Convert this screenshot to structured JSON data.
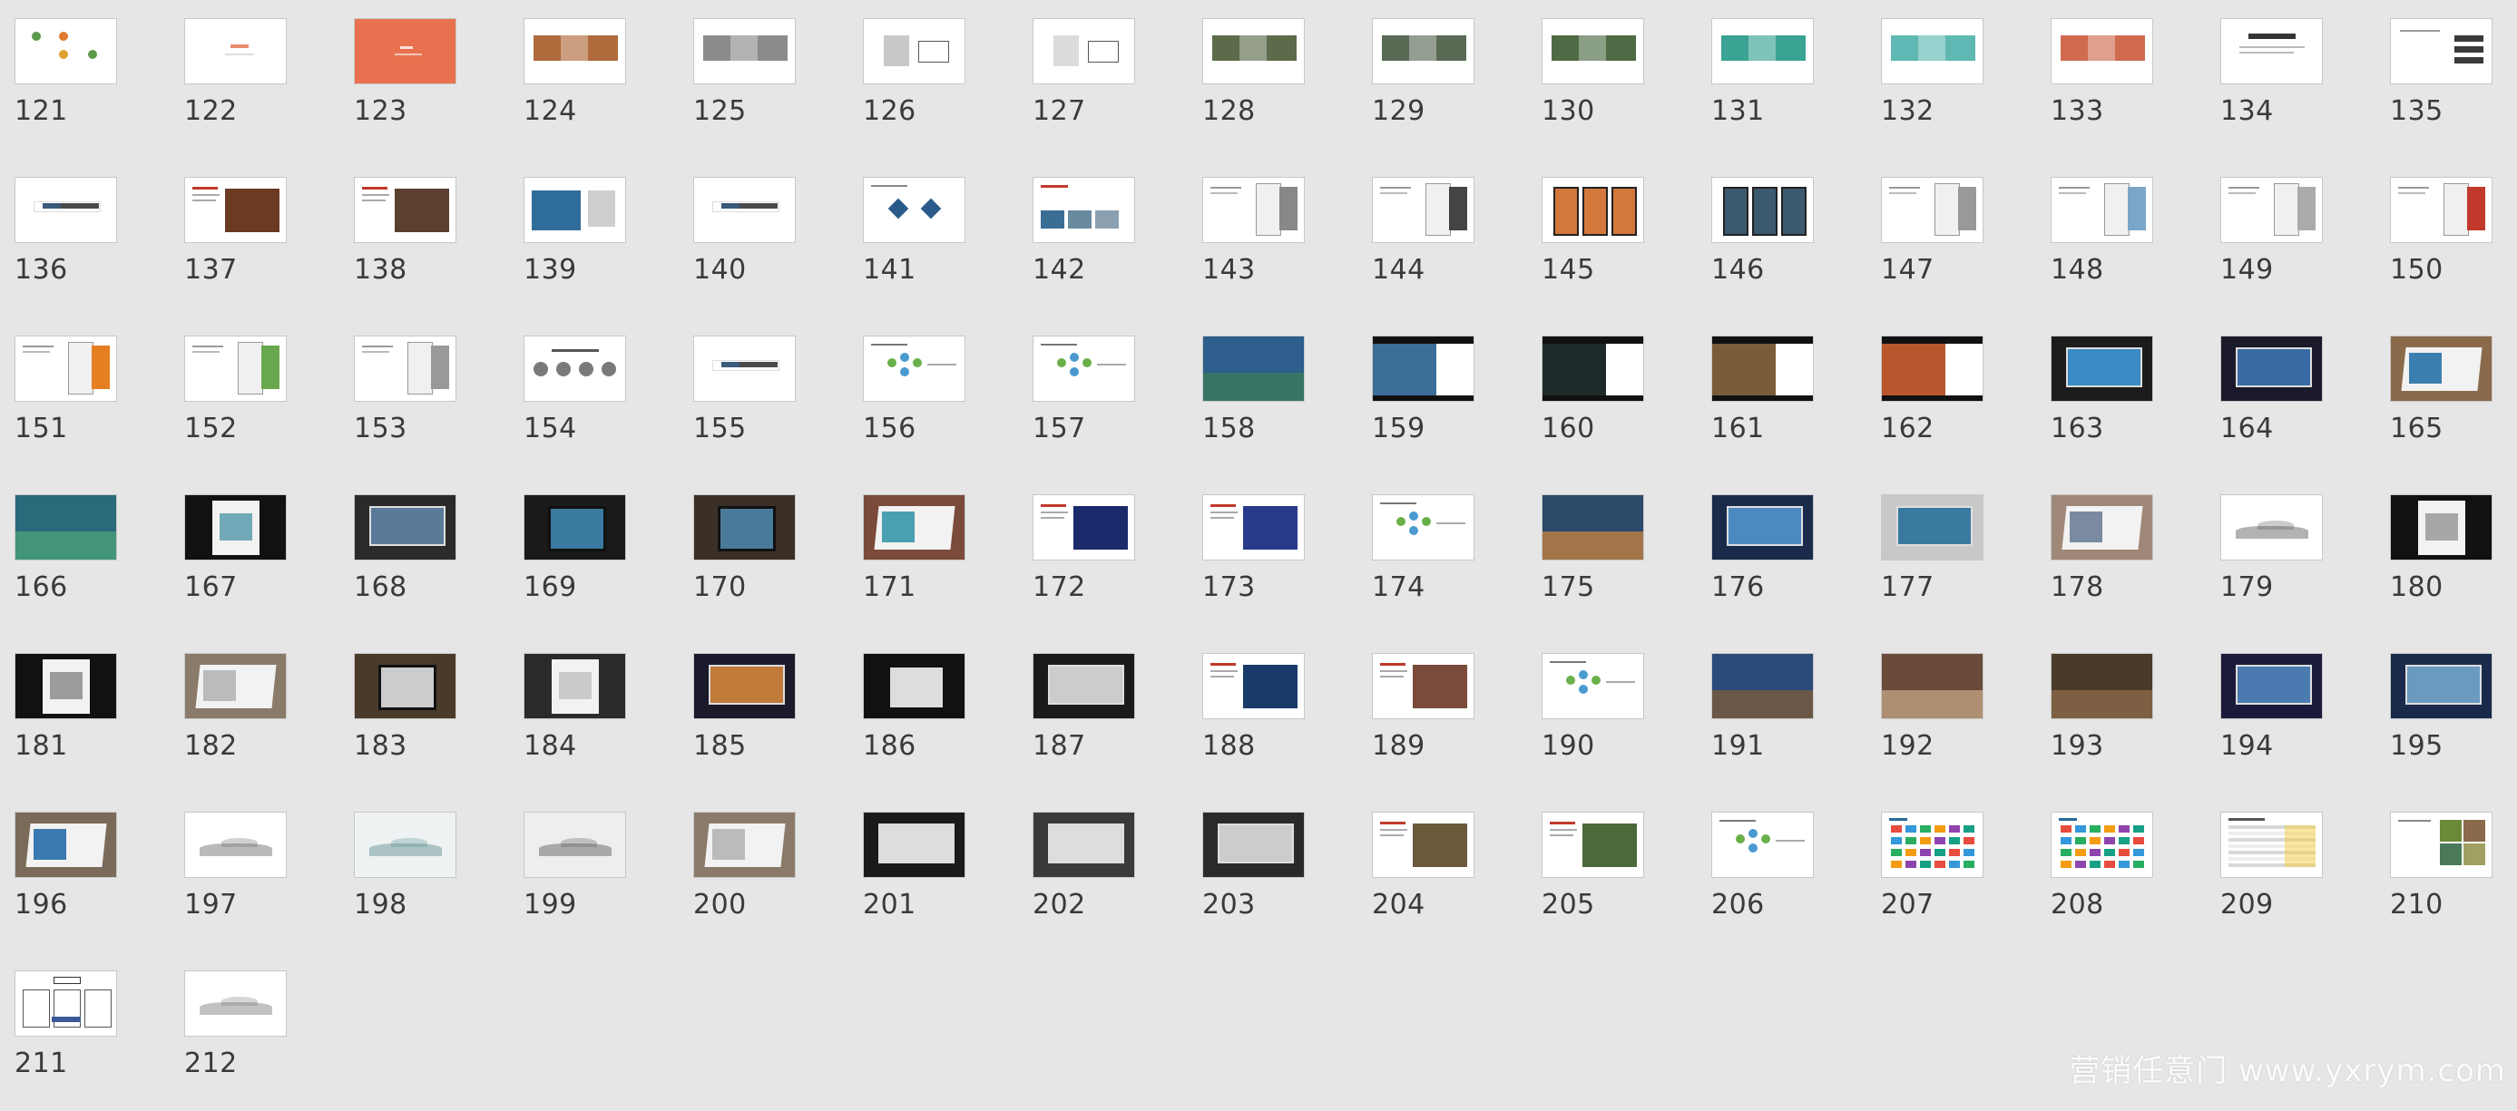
{
  "watermark": "营销任意门 www.yxrym.com",
  "grid": {
    "columns": 15
  },
  "slides": [
    {
      "label": "121",
      "bg": "#ffffff",
      "style": "circles"
    },
    {
      "label": "122",
      "bg": "#ffffff",
      "style": "text-light"
    },
    {
      "label": "123",
      "bg": "#e8714f",
      "style": "text-light-on-color"
    },
    {
      "label": "124",
      "bg": "#ffffff",
      "style": "photo-strip",
      "accent": "#b06a3b"
    },
    {
      "label": "125",
      "bg": "#ffffff",
      "style": "photo-strip",
      "accent": "#8b8b8b"
    },
    {
      "label": "126",
      "bg": "#ffffff",
      "style": "objects",
      "accent": "#c8c8c8"
    },
    {
      "label": "127",
      "bg": "#ffffff",
      "style": "objects",
      "accent": "#dcdcdc"
    },
    {
      "label": "128",
      "bg": "#ffffff",
      "style": "photo-strip",
      "accent": "#5c6b4a"
    },
    {
      "label": "129",
      "bg": "#ffffff",
      "style": "photo-strip",
      "accent": "#596a55"
    },
    {
      "label": "130",
      "bg": "#ffffff",
      "style": "photo-strip",
      "accent": "#4d6b45"
    },
    {
      "label": "131",
      "bg": "#ffffff",
      "style": "photo-strip",
      "accent": "#3aa393"
    },
    {
      "label": "132",
      "bg": "#ffffff",
      "style": "photo-strip",
      "accent": "#5fb8b3"
    },
    {
      "label": "133",
      "bg": "#ffffff",
      "style": "photo-strip",
      "accent": "#d06b4f"
    },
    {
      "label": "134",
      "bg": "#ffffff",
      "style": "title-text"
    },
    {
      "label": "135",
      "bg": "#ffffff",
      "style": "menu-list"
    },
    {
      "label": "136",
      "bg": "#ffffff",
      "style": "section-bar"
    },
    {
      "label": "137",
      "bg": "#ffffff",
      "style": "photo-right",
      "accent": "#6b3a22"
    },
    {
      "label": "138",
      "bg": "#ffffff",
      "style": "photo-right",
      "accent": "#5b4030"
    },
    {
      "label": "139",
      "bg": "#ffffff",
      "style": "photo-left",
      "accent": "#2f6e9c"
    },
    {
      "label": "140",
      "bg": "#ffffff",
      "style": "section-bar"
    },
    {
      "label": "141",
      "bg": "#ffffff",
      "style": "diamonds"
    },
    {
      "label": "142",
      "bg": "#ffffff",
      "style": "photo-row",
      "accent": "#3b6e95"
    },
    {
      "label": "143",
      "bg": "#ffffff",
      "style": "phone",
      "accent": "#888888"
    },
    {
      "label": "144",
      "bg": "#ffffff",
      "style": "phone",
      "accent": "#444444"
    },
    {
      "label": "145",
      "bg": "#ffffff",
      "style": "phones3",
      "accent": "#d2783a"
    },
    {
      "label": "146",
      "bg": "#ffffff",
      "style": "phones3",
      "accent": "#3c5a6e"
    },
    {
      "label": "147",
      "bg": "#ffffff",
      "style": "phone",
      "accent": "#999999"
    },
    {
      "label": "148",
      "bg": "#ffffff",
      "style": "phone",
      "accent": "#7aa7c9"
    },
    {
      "label": "149",
      "bg": "#ffffff",
      "style": "phone",
      "accent": "#aaaaaa"
    },
    {
      "label": "150",
      "bg": "#ffffff",
      "style": "phone",
      "accent": "#c0392b"
    },
    {
      "label": "151",
      "bg": "#ffffff",
      "style": "phone",
      "accent": "#e67e22"
    },
    {
      "label": "152",
      "bg": "#ffffff",
      "style": "phone",
      "accent": "#6aa84f"
    },
    {
      "label": "153",
      "bg": "#ffffff",
      "style": "phone",
      "accent": "#999999"
    },
    {
      "label": "154",
      "bg": "#ffffff",
      "style": "four-circles"
    },
    {
      "label": "155",
      "bg": "#ffffff",
      "style": "section-bar"
    },
    {
      "label": "156",
      "bg": "#ffffff",
      "style": "hex-diagram"
    },
    {
      "label": "157",
      "bg": "#ffffff",
      "style": "hex-diagram"
    },
    {
      "label": "158",
      "bg": "#2d5e8c",
      "style": "full-photo",
      "accent": "#3a7a5a"
    },
    {
      "label": "159",
      "bg": "#ffffff",
      "style": "cinema",
      "accent": "#3c6e9a"
    },
    {
      "label": "160",
      "bg": "#ffffff",
      "style": "cinema",
      "accent": "#1f2a2a"
    },
    {
      "label": "161",
      "bg": "#ffffff",
      "style": "cinema",
      "accent": "#7a5c3a"
    },
    {
      "label": "162",
      "bg": "#ffffff",
      "style": "cinema",
      "accent": "#b8572e"
    },
    {
      "label": "163",
      "bg": "#1c1c1c",
      "style": "billboard",
      "accent": "#3a8ac4"
    },
    {
      "label": "164",
      "bg": "#1a1a2a",
      "style": "billboard",
      "accent": "#3a6aa4"
    },
    {
      "label": "165",
      "bg": "#8a6a4a",
      "style": "book",
      "accent": "#3b7fb0"
    },
    {
      "label": "166",
      "bg": "#2a6a7a",
      "style": "full-photo",
      "accent": "#4aa07a"
    },
    {
      "label": "167",
      "bg": "#111111",
      "style": "poster",
      "accent": "#3a8aa0"
    },
    {
      "label": "168",
      "bg": "#2a2a2a",
      "style": "billboard",
      "accent": "#5a7a9a"
    },
    {
      "label": "169",
      "bg": "#1a1a1a",
      "style": "tablet",
      "accent": "#3a7aa0"
    },
    {
      "label": "170",
      "bg": "#3a3028",
      "style": "tablet",
      "accent": "#4a7a9a"
    },
    {
      "label": "171",
      "bg": "#7a4a3a",
      "style": "book",
      "accent": "#4aa0b0"
    },
    {
      "label": "172",
      "bg": "#ffffff",
      "style": "photo-right",
      "accent": "#1a2a6a"
    },
    {
      "label": "173",
      "bg": "#ffffff",
      "style": "photo-right",
      "accent": "#2a3a8a"
    },
    {
      "label": "174",
      "bg": "#ffffff",
      "style": "hex-diagram"
    },
    {
      "label": "175",
      "bg": "#2a4a6a",
      "style": "full-photo",
      "accent": "#c08040"
    },
    {
      "label": "176",
      "bg": "#1a2a4a",
      "style": "billboard",
      "accent": "#4a8ac0"
    },
    {
      "label": "177",
      "bg": "#c8c8c8",
      "style": "billboard",
      "accent": "#3a7aa0"
    },
    {
      "label": "178",
      "bg": "#a08878",
      "style": "book",
      "accent": "#7a8aa0"
    },
    {
      "label": "179",
      "bg": "#ffffff",
      "style": "ink",
      "accent": "#555555"
    },
    {
      "label": "180",
      "bg": "#111111",
      "style": "poster",
      "accent": "#888888"
    },
    {
      "label": "181",
      "bg": "#111111",
      "style": "poster",
      "accent": "#777777"
    },
    {
      "label": "182",
      "bg": "#8a7a6a",
      "style": "book",
      "accent": "#bbbbbb"
    },
    {
      "label": "183",
      "bg": "#4a3a2a",
      "style": "tablet",
      "accent": "#cccccc"
    },
    {
      "label": "184",
      "bg": "#2a2a2a",
      "style": "poster",
      "accent": "#bbbbbb"
    },
    {
      "label": "185",
      "bg": "#1a1a2a",
      "style": "billboard",
      "accent": "#c07a3a"
    },
    {
      "label": "186",
      "bg": "#111111",
      "style": "tablet",
      "accent": "#dddddd"
    },
    {
      "label": "187",
      "bg": "#1a1a1a",
      "style": "billboard",
      "accent": "#cccccc"
    },
    {
      "label": "188",
      "bg": "#ffffff",
      "style": "photo-right",
      "accent": "#1a3a6a"
    },
    {
      "label": "189",
      "bg": "#ffffff",
      "style": "photo-right",
      "accent": "#7a4a3a"
    },
    {
      "label": "190",
      "bg": "#ffffff",
      "style": "hex-diagram"
    },
    {
      "label": "191",
      "bg": "#2a4a7a",
      "style": "full-photo",
      "accent": "#7a5a3a"
    },
    {
      "label": "192",
      "bg": "#6a4a3a",
      "style": "full-photo",
      "accent": "#c0a080"
    },
    {
      "label": "193",
      "bg": "#4a3a2a",
      "style": "full-photo",
      "accent": "#8a6a4a"
    },
    {
      "label": "194",
      "bg": "#1a1a3a",
      "style": "billboard",
      "accent": "#4a7ab0"
    },
    {
      "label": "195",
      "bg": "#1a2a4a",
      "style": "billboard",
      "accent": "#6a9ac0"
    },
    {
      "label": "196",
      "bg": "#7a6a5a",
      "style": "book",
      "accent": "#3a7ab0"
    },
    {
      "label": "197",
      "bg": "#ffffff",
      "style": "ink",
      "accent": "#666666"
    },
    {
      "label": "198",
      "bg": "#eef2f2",
      "style": "ink",
      "accent": "#5a8a8a"
    },
    {
      "label": "199",
      "bg": "#eeeeee",
      "style": "ink",
      "accent": "#555555"
    },
    {
      "label": "200",
      "bg": "#8a7a6a",
      "style": "book",
      "accent": "#bbbbbb"
    },
    {
      "label": "201",
      "bg": "#1a1a1a",
      "style": "billboard",
      "accent": "#dddddd"
    },
    {
      "label": "202",
      "bg": "#3a3a3a",
      "style": "billboard",
      "accent": "#dddddd"
    },
    {
      "label": "203",
      "bg": "#2a2a2a",
      "style": "billboard",
      "accent": "#cccccc"
    },
    {
      "label": "204",
      "bg": "#ffffff",
      "style": "photo-right",
      "accent": "#6a5a3a"
    },
    {
      "label": "205",
      "bg": "#ffffff",
      "style": "photo-right",
      "accent": "#4a6a3a"
    },
    {
      "label": "206",
      "bg": "#ffffff",
      "style": "hex-diagram"
    },
    {
      "label": "207",
      "bg": "#ffffff",
      "style": "logos"
    },
    {
      "label": "208",
      "bg": "#ffffff",
      "style": "logos"
    },
    {
      "label": "209",
      "bg": "#ffffff",
      "style": "table"
    },
    {
      "label": "210",
      "bg": "#ffffff",
      "style": "photo-grid",
      "accent": "#6a8a3a"
    },
    {
      "label": "211",
      "bg": "#ffffff",
      "style": "org-chart"
    },
    {
      "label": "212",
      "bg": "#ffffff",
      "style": "ink",
      "accent": "#777777"
    }
  ]
}
